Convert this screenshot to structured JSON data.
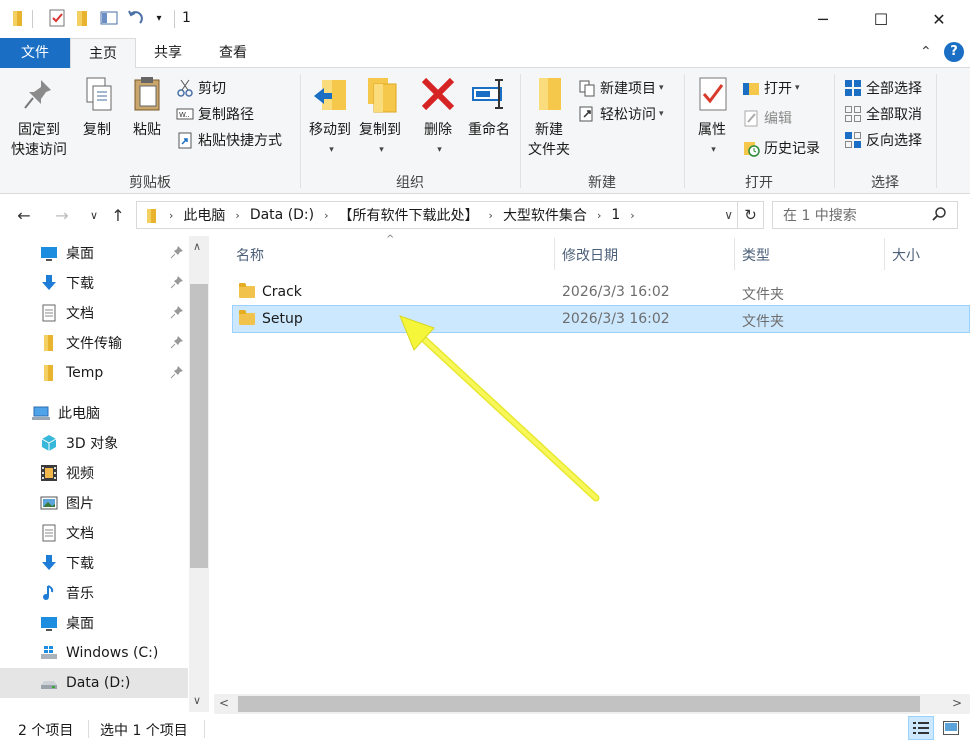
{
  "window": {
    "title": "1",
    "controls": {
      "minimize": "─",
      "maximize": "☐",
      "close": "✕"
    }
  },
  "ribbon_tabs": [
    "文件",
    "主页",
    "共享",
    "查看"
  ],
  "ribbon": {
    "clipboard": {
      "label": "剪贴板",
      "pin_line1": "固定到",
      "pin_line2": "快速访问",
      "copy": "复制",
      "paste": "粘贴",
      "cut": "剪切",
      "copy_path": "复制路径",
      "paste_shortcut": "粘贴快捷方式"
    },
    "organize": {
      "label": "组织",
      "move_to": "移动到",
      "copy_to": "复制到",
      "delete": "删除",
      "rename": "重命名"
    },
    "new": {
      "label": "新建",
      "new_folder_line1": "新建",
      "new_folder_line2": "文件夹",
      "new_item": "新建项目",
      "easy_access": "轻松访问"
    },
    "open": {
      "label": "打开",
      "properties": "属性",
      "open": "打开",
      "edit": "编辑",
      "history": "历史记录"
    },
    "select": {
      "label": "选择",
      "select_all": "全部选择",
      "select_none": "全部取消",
      "invert": "反向选择"
    }
  },
  "address": {
    "crumbs": [
      "此电脑",
      "Data (D:)",
      "【所有软件下载此处】",
      "大型软件集合",
      "1"
    ],
    "search_placeholder": "在 1 中搜索"
  },
  "nav_pane": {
    "quick_access": [
      {
        "label": "桌面",
        "icon": "desktop-icon",
        "pinned": true
      },
      {
        "label": "下载",
        "icon": "download-icon",
        "pinned": true
      },
      {
        "label": "文档",
        "icon": "document-icon",
        "pinned": true
      },
      {
        "label": "文件传输",
        "icon": "folder-icon",
        "pinned": true
      },
      {
        "label": "Temp",
        "icon": "folder-icon",
        "pinned": true
      }
    ],
    "this_pc": {
      "label": "此电脑",
      "icon": "computer-icon"
    },
    "this_pc_items": [
      {
        "label": "3D 对象",
        "icon": "cube-icon"
      },
      {
        "label": "视频",
        "icon": "video-icon"
      },
      {
        "label": "图片",
        "icon": "picture-icon"
      },
      {
        "label": "文档",
        "icon": "document-icon"
      },
      {
        "label": "下载",
        "icon": "download-icon"
      },
      {
        "label": "音乐",
        "icon": "music-icon"
      },
      {
        "label": "桌面",
        "icon": "desktop-icon"
      },
      {
        "label": "Windows (C:)",
        "icon": "windows-drive-icon"
      },
      {
        "label": "Data (D:)",
        "icon": "drive-icon",
        "selected": true
      }
    ]
  },
  "file_list": {
    "columns": [
      "名称",
      "修改日期",
      "类型",
      "大小"
    ],
    "rows": [
      {
        "name": "Crack",
        "modified": "2026/3/3 16:02",
        "type": "文件夹",
        "selected": false
      },
      {
        "name": "Setup",
        "modified": "2026/3/3 16:02",
        "type": "文件夹",
        "selected": true
      }
    ]
  },
  "status": {
    "item_count": "2 个项目",
    "selected": "选中 1 个项目"
  },
  "colors": {
    "accent": "#1a6fc4",
    "selection_bg": "#cce8ff",
    "annotation_arrow": "#f5f53a"
  }
}
